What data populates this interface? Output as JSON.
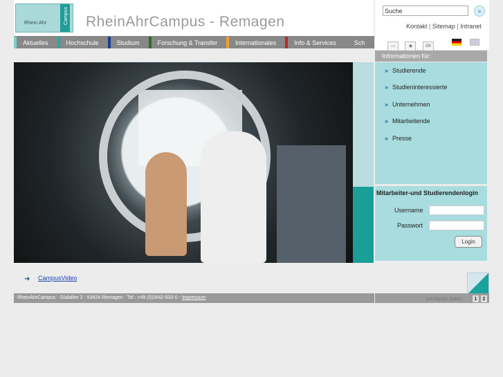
{
  "header": {
    "logo_text": "Rhein Ahr",
    "logo_vertical": "Campus",
    "title": "RheinAhrCampus - Remagen"
  },
  "search": {
    "value": "Suche",
    "go_glyph": "»"
  },
  "top_links": [
    "Kontakt",
    "Sitemap",
    "Intranet"
  ],
  "util_icons": [
    "print-icon",
    "audio-icon",
    "ok-icon"
  ],
  "languages": [
    "de-flag-icon",
    "en-flag-icon"
  ],
  "nav": {
    "items": [
      {
        "label": "Aktuelles",
        "color": "#7ccfcb"
      },
      {
        "label": "Hochschule",
        "color": "#27a9a2"
      },
      {
        "label": "Studium",
        "color": "#1b3f8c"
      },
      {
        "label": "Forschung & Transfer",
        "color": "#2f6b2a"
      },
      {
        "label": "Internationales",
        "color": "#f0a036"
      },
      {
        "label": "Info & Services",
        "color": "#b8282d"
      },
      {
        "label": "Sch",
        "color": "#888888"
      }
    ]
  },
  "info": {
    "heading": "Informationen für:",
    "items": [
      "Studierende",
      "Studieninteressierte",
      "Unternehmen",
      "Mitarbeitende",
      "Presse"
    ]
  },
  "login": {
    "title": "Mitarbeiter-und Studierendenlogin",
    "user_label": "Username",
    "pass_label": "Passwort",
    "button": "Login"
  },
  "video": {
    "arrow": "➜",
    "label": "CampusVideo"
  },
  "footer": {
    "text": "RheinAhrCampus  -  Südallee 2  -  53424 Remagen  -  Tel.: +49 (0)2642-932-0 -  ",
    "impressum": "Impressum",
    "fontsize_label": "Schriftgröße ändern",
    "size1": "1",
    "size2": "2"
  }
}
